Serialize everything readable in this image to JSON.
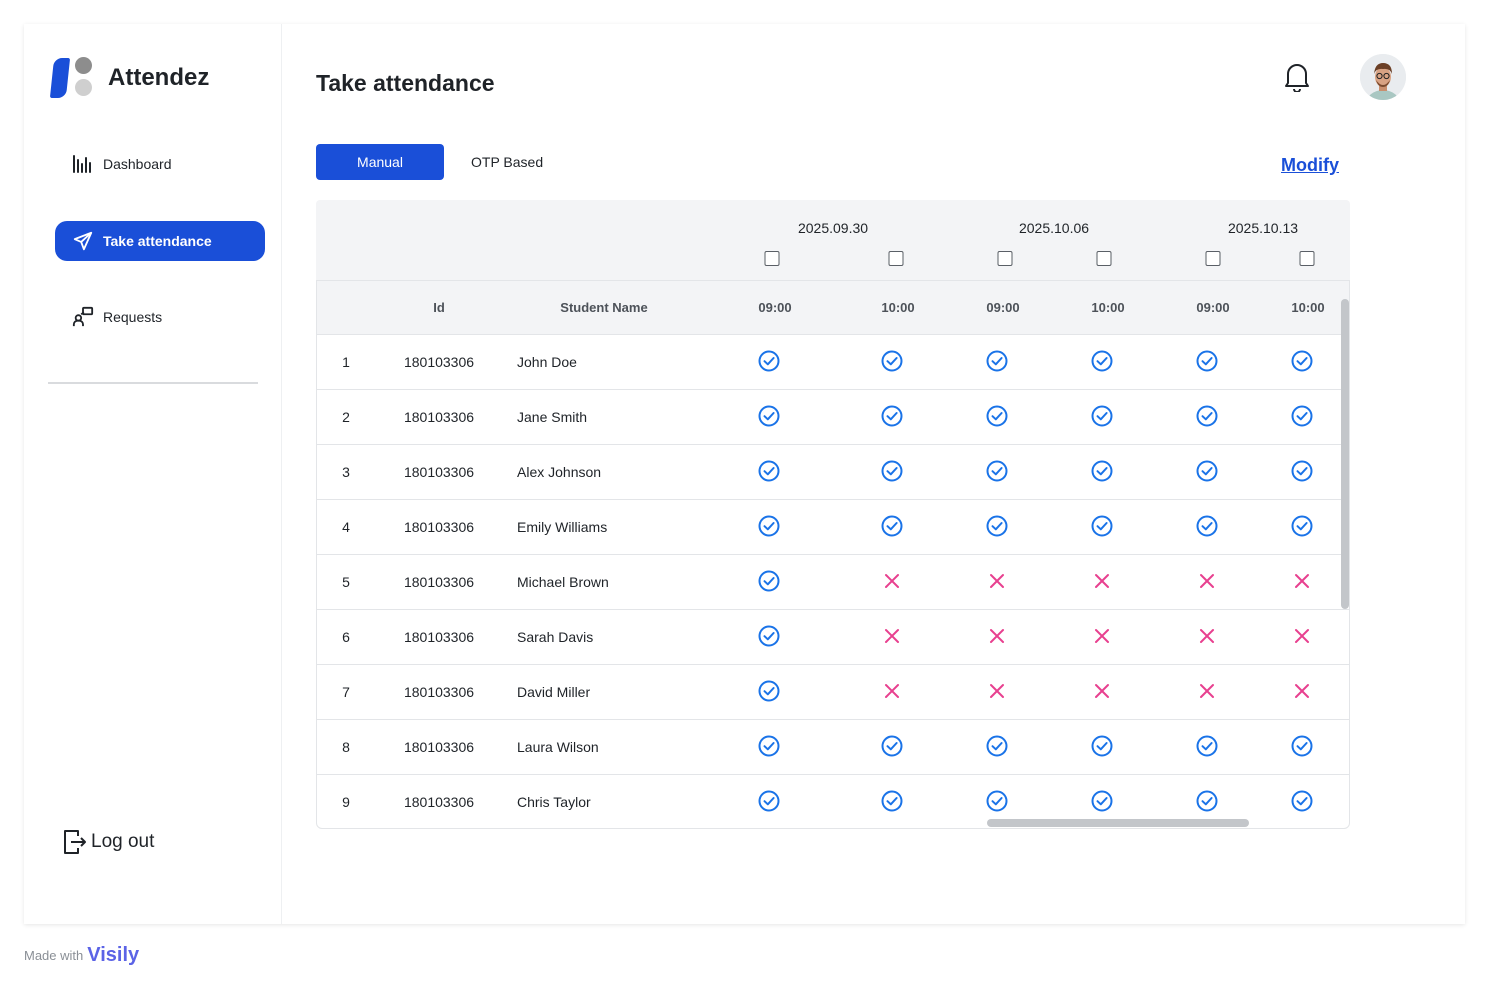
{
  "app": {
    "name": "Attendez"
  },
  "sidebar": {
    "items": [
      {
        "label": "Dashboard",
        "icon": "bar-chart-icon",
        "active": false
      },
      {
        "label": "Take attendance",
        "icon": "send-icon",
        "active": true
      },
      {
        "label": "Requests",
        "icon": "requests-icon",
        "active": false
      }
    ],
    "logout": "Log out"
  },
  "header": {
    "title": "Take attendance"
  },
  "tabs": [
    {
      "label": "Manual",
      "active": true
    },
    {
      "label": "OTP Based",
      "active": false
    }
  ],
  "modify_label": "Modify",
  "table": {
    "dates": [
      "2025.09.30",
      "2025.10.06",
      "2025.10.13"
    ],
    "columns": {
      "id": "Id",
      "name": "Student Name"
    },
    "slots": [
      "09:00",
      "10:00",
      "09:00",
      "10:00",
      "09:00",
      "10:00"
    ],
    "rows": [
      {
        "n": "1",
        "id": "180103306",
        "name": "John Doe",
        "att": [
          1,
          1,
          1,
          1,
          1,
          1
        ]
      },
      {
        "n": "2",
        "id": "180103306",
        "name": "Jane Smith",
        "att": [
          1,
          1,
          1,
          1,
          1,
          1
        ]
      },
      {
        "n": "3",
        "id": "180103306",
        "name": "Alex Johnson",
        "att": [
          1,
          1,
          1,
          1,
          1,
          1
        ]
      },
      {
        "n": "4",
        "id": "180103306",
        "name": "Emily Williams",
        "att": [
          1,
          1,
          1,
          1,
          1,
          1
        ]
      },
      {
        "n": "5",
        "id": "180103306",
        "name": "Michael Brown",
        "att": [
          1,
          0,
          0,
          0,
          0,
          0
        ]
      },
      {
        "n": "6",
        "id": "180103306",
        "name": "Sarah Davis",
        "att": [
          1,
          0,
          0,
          0,
          0,
          0
        ]
      },
      {
        "n": "7",
        "id": "180103306",
        "name": "David Miller",
        "att": [
          1,
          0,
          0,
          0,
          0,
          0
        ]
      },
      {
        "n": "8",
        "id": "180103306",
        "name": "Laura Wilson",
        "att": [
          1,
          1,
          1,
          1,
          1,
          1
        ]
      },
      {
        "n": "9",
        "id": "180103306",
        "name": "Chris Taylor",
        "att": [
          1,
          1,
          1,
          1,
          1,
          1
        ]
      }
    ]
  },
  "colors": {
    "accent": "#1a4fd8",
    "present": "#1a73e8",
    "absent": "#e8408f"
  },
  "footer": {
    "made_with": "Made with",
    "brand": "Visily"
  }
}
